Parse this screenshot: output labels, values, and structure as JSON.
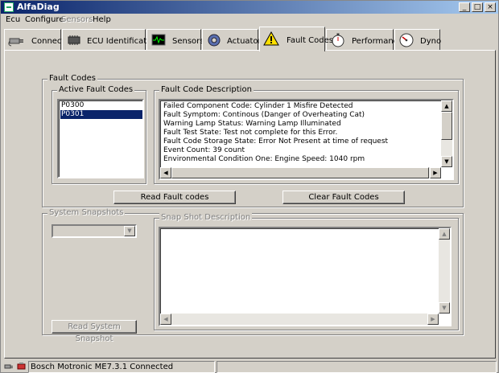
{
  "window": {
    "title": "AlfaDiag"
  },
  "menu": [
    {
      "label": "Ecu",
      "enabled": true
    },
    {
      "label": "Configure",
      "enabled": true
    },
    {
      "label": "Sensors",
      "enabled": false
    },
    {
      "label": "Help",
      "enabled": true
    }
  ],
  "tabs": [
    {
      "label": "Connect",
      "icon": "plug-icon"
    },
    {
      "label": "ECU Identification",
      "icon": "chip-icon"
    },
    {
      "label": "Sensors",
      "icon": "oscilloscope-icon"
    },
    {
      "label": "Actuators",
      "icon": "gear-icon"
    },
    {
      "label": "Fault Codes",
      "icon": "warning-icon",
      "active": true
    },
    {
      "label": "Performance",
      "icon": "stopwatch-icon"
    },
    {
      "label": "Dyno",
      "icon": "gauge-icon"
    }
  ],
  "fault_codes": {
    "group_title": "Fault Codes",
    "active_title": "Active Fault Codes",
    "active_codes": [
      {
        "code": "P0300",
        "selected": false
      },
      {
        "code": "P0301",
        "selected": true
      }
    ],
    "description_title": "Fault Code Description",
    "description_lines": [
      "Failed Component Code: Cylinder 1 Misfire Detected",
      "Fault Symptom: Continous (Danger of Overheating Cat)",
      "Warning Lamp Status: Warning Lamp Illuminated",
      "Fault Test State: Test not complete for this Error.",
      "Fault Code Storage State: Error Not Present at time of request",
      "Event Count: 39 count",
      "Environmental Condition One: Engine Speed: 1040 rpm"
    ],
    "read_button": "Read Fault codes",
    "clear_button": "Clear Fault Codes"
  },
  "snapshots": {
    "group_title": "System Snapshots",
    "description_title": "Snap Shot Description",
    "combo_value": "",
    "read_button": "Read System Snapshot"
  },
  "status": {
    "text": "Bosch Motronic ME7.3.1 Connected"
  },
  "colors": {
    "selection": "#0a246a",
    "face": "#d4d0c8",
    "title_start": "#0a246a",
    "title_end": "#a6caf0"
  }
}
